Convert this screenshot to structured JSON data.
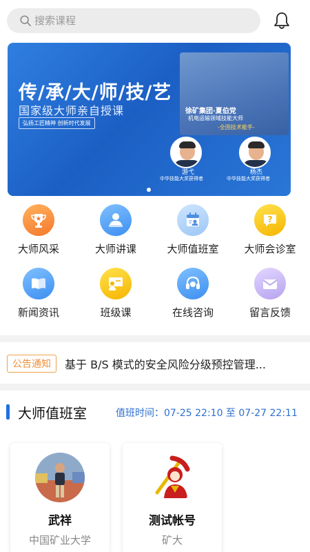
{
  "search": {
    "placeholder": "搜索课程"
  },
  "banner": {
    "title": "传/承/大/师/技/艺",
    "subtitle": "国家级大师亲自授课",
    "slogan": "弘扬工匠精神 创新时代发展",
    "main_name": "徐矿集团·夏伯党",
    "main_role": "机电运输领域技能大师",
    "main_tag": "-全国技术能手-",
    "people": [
      {
        "name": "游弋",
        "award": "中华技能大奖获得者"
      },
      {
        "name": "杨杰",
        "award": "中华技能大奖获得者"
      }
    ]
  },
  "grid": [
    {
      "label": "大师风采",
      "icon": "trophy-icon",
      "color": "#f5782d"
    },
    {
      "label": "大师讲课",
      "icon": "teacher-icon",
      "color": "#3d8ff0"
    },
    {
      "label": "大师值班室",
      "icon": "calendar-person-icon",
      "color": "#9cc7f5"
    },
    {
      "label": "大师会诊室",
      "icon": "question-chat-icon",
      "color": "#f6b500"
    },
    {
      "label": "新闻资讯",
      "icon": "book-icon",
      "color": "#3d8ff0"
    },
    {
      "label": "班级课",
      "icon": "classroom-icon",
      "color": "#f6b500"
    },
    {
      "label": "在线咨询",
      "icon": "headset-icon",
      "color": "#3d8ff0"
    },
    {
      "label": "留言反馈",
      "icon": "envelope-icon",
      "color": "#b6a3f0"
    }
  ],
  "notice": {
    "badge": "公告通知",
    "text": "基于 B/S 模式的安全风险分级预控管理..."
  },
  "duty_room": {
    "title": "大师值班室",
    "duty_time": "值班时间：07-25 22:10 至 07-27 22:11",
    "cards": [
      {
        "name": "武祥",
        "org": "中国矿业大学"
      },
      {
        "name": "测试帐号",
        "org": "矿大"
      }
    ]
  }
}
